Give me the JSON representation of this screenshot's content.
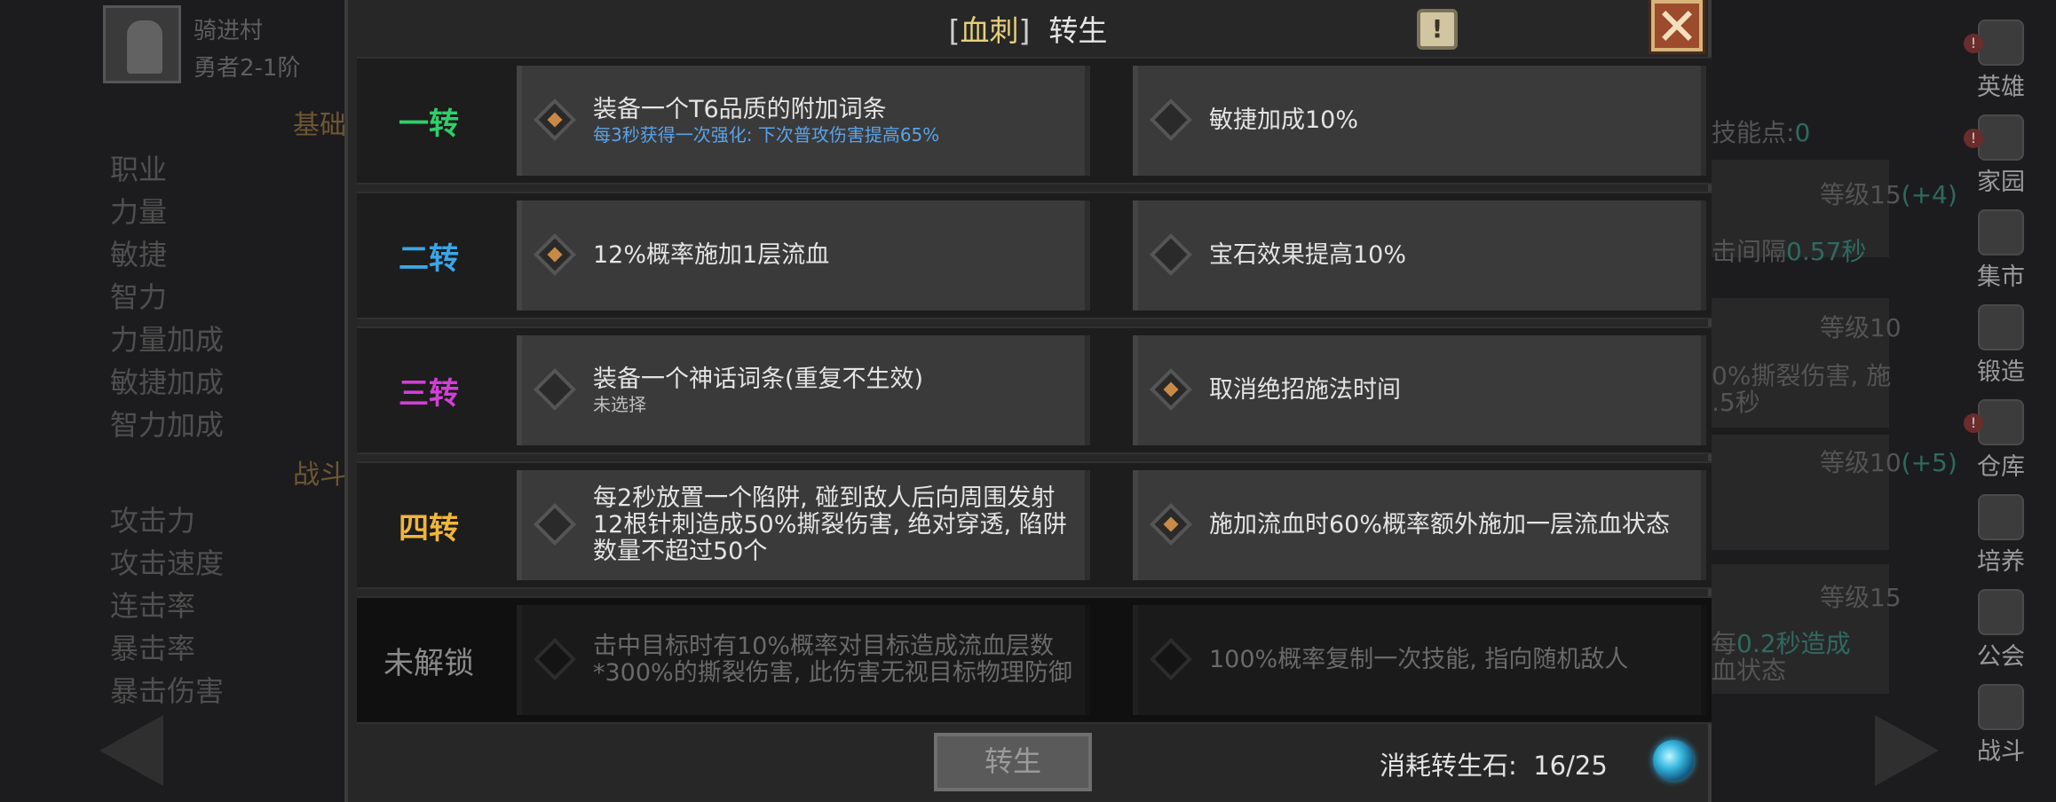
{
  "background": {
    "hero_name": "骑进村",
    "hero_rank": "勇者2-1阶",
    "section_basic": "基础",
    "section_battle": "战斗",
    "stats_basic": [
      "职业",
      "力量",
      "敏捷",
      "智力",
      "力量加成",
      "敏捷加成",
      "智力加成"
    ],
    "stats_battle": [
      "攻击力",
      "攻击速度",
      "连击率",
      "暴击率",
      "暴击伤害"
    ],
    "skill_points_label": "技能点:",
    "skill_points_value": "0",
    "right_lines": [
      {
        "text": "等级15",
        "extra": "(+4)"
      },
      {
        "text": "击间隔",
        "extra": "0.57秒"
      },
      {
        "text": "等级10",
        "extra": ""
      },
      {
        "text": "0%撕裂伤害, 施",
        "extra": ""
      },
      {
        "text": ".5秒",
        "extra": ""
      },
      {
        "text": "等级10",
        "extra": "(+5)"
      },
      {
        "text": "等级15",
        "extra": ""
      },
      {
        "text": "每",
        "extra": "0.2秒造成"
      },
      {
        "text": "血状态",
        "extra": ""
      }
    ]
  },
  "nav": [
    {
      "label": "英雄",
      "icon": "hero-icon",
      "alert": true
    },
    {
      "label": "家园",
      "icon": "home-icon",
      "alert": true
    },
    {
      "label": "集市",
      "icon": "market-icon",
      "alert": false
    },
    {
      "label": "锻造",
      "icon": "anvil-icon",
      "alert": false
    },
    {
      "label": "仓库",
      "icon": "warehouse-icon",
      "alert": true
    },
    {
      "label": "培养",
      "icon": "train-icon",
      "alert": false
    },
    {
      "label": "公会",
      "icon": "guild-icon",
      "alert": false
    },
    {
      "label": "战斗",
      "icon": "battle-portal-icon",
      "alert": false
    }
  ],
  "modal": {
    "title_open": "[",
    "title_class": "血刺",
    "title_close": "]",
    "title_suffix": "转生",
    "info_symbol": "!",
    "rows": [
      {
        "tier": "一转",
        "color": "#2fcf6a",
        "locked": false,
        "a": {
          "text": "装备一个T6品质的附加词条",
          "sub": "每3秒获得一次强化: 下次普攻伤害提高65%",
          "selected": true
        },
        "b": {
          "text": "敏捷加成10%",
          "sub": "",
          "selected": false
        }
      },
      {
        "tier": "二转",
        "color": "#3aa6e8",
        "locked": false,
        "a": {
          "text": "12%概率施加1层流血",
          "sub": "",
          "selected": true
        },
        "b": {
          "text": "宝石效果提高10%",
          "sub": "",
          "selected": false
        }
      },
      {
        "tier": "三转",
        "color": "#d23fd6",
        "locked": false,
        "a": {
          "text": "装备一个神话词条(重复不生效)",
          "sub": "未选择",
          "selected": false
        },
        "b": {
          "text": "取消绝招施法时间",
          "sub": "",
          "selected": true
        }
      },
      {
        "tier": "四转",
        "color": "#f0b53a",
        "locked": false,
        "a": {
          "text": "每2秒放置一个陷阱, 碰到敌人后向周围发射12根针刺造成50%撕裂伤害, 绝对穿透, 陷阱数量不超过50个",
          "sub": "",
          "selected": false
        },
        "b": {
          "text": "施加流血时60%概率额外施加一层流血状态",
          "sub": "",
          "selected": true
        }
      },
      {
        "tier": "未解锁",
        "color": "#8a8a8a",
        "locked": true,
        "a": {
          "text": "击中目标时有10%概率对目标造成流血层数*300%的撕裂伤害, 此伤害无视目标物理防御",
          "sub": "",
          "selected": false
        },
        "b": {
          "text": "100%概率复制一次技能, 指向随机敌人",
          "sub": "",
          "selected": false
        }
      }
    ],
    "rebirth_button": "转生",
    "cost_label": "消耗转生石:",
    "cost_value": "16/25"
  }
}
